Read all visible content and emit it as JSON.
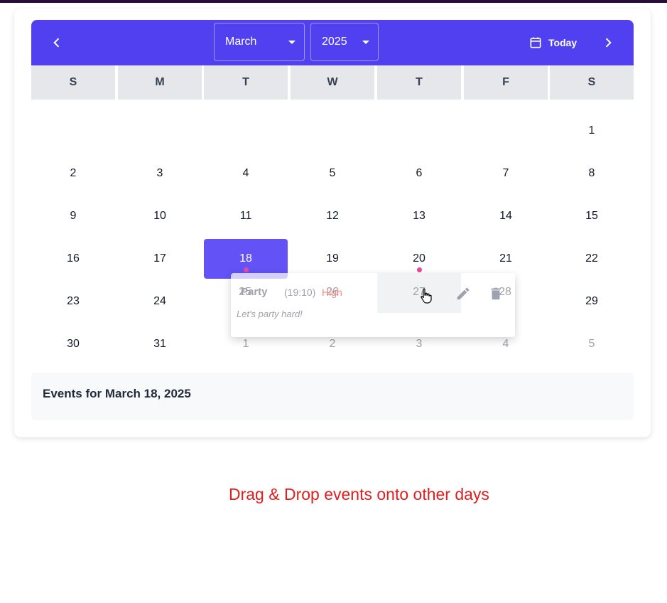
{
  "toolbar": {
    "month": "March",
    "year": "2025",
    "today_label": "Today",
    "color": "#5140f0"
  },
  "weekdays": [
    "S",
    "M",
    "T",
    "W",
    "T",
    "F",
    "S"
  ],
  "calendar": {
    "rows": [
      [
        "",
        "",
        "",
        "",
        "",
        "",
        "1"
      ],
      [
        "2",
        "3",
        "4",
        "5",
        "6",
        "7",
        "8"
      ],
      [
        "9",
        "10",
        "11",
        "12",
        "13",
        "14",
        "15"
      ],
      [
        "16",
        "17",
        "18",
        "19",
        "20",
        "21",
        "22"
      ],
      [
        "23",
        "24",
        "",
        "",
        "",
        "",
        "29"
      ],
      [
        "30",
        "31",
        "",
        "",
        "",
        "",
        ""
      ]
    ],
    "selected_day": "18",
    "event_dot_days": [
      "18",
      "20"
    ],
    "dot_color": "#ec4899"
  },
  "drag_popup": {
    "title": "Party",
    "time": "(19:10)",
    "priority": "High",
    "description": "Let's party hard!",
    "behind_numbers": [
      "25",
      "26",
      "27",
      "28"
    ],
    "behind_next_month": [
      "1",
      "2",
      "3",
      "4",
      "5"
    ]
  },
  "events_panel": {
    "title": "Events for March 18, 2025"
  },
  "footer": {
    "note": "Drag & Drop events onto other days",
    "color": "#e11d1d"
  },
  "icons": {
    "prev": "chevron-left-icon",
    "next": "chevron-right-icon",
    "today": "calendar-icon",
    "edit": "pencil-icon",
    "delete": "trash-icon",
    "cursor": "hand-pointer-icon"
  }
}
